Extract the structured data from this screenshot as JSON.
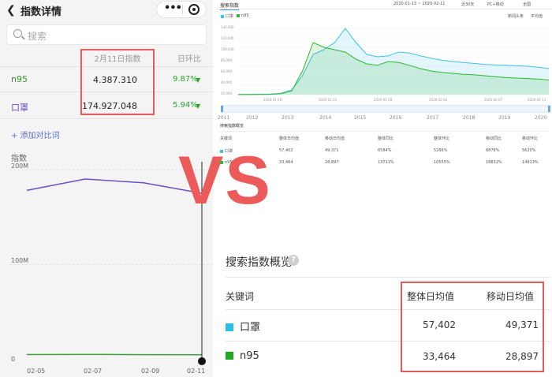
{
  "mobile": {
    "back_icon": "chevron-left-icon",
    "title": "指数详情",
    "capsule_more": "•••",
    "search_placeholder": "搜索",
    "header_date": "2月11日指数",
    "header_ring": "日环比",
    "rows": [
      {
        "keyword": "n95",
        "value": "4.387.310",
        "change": "9.87%",
        "color": "#3a8f2f"
      },
      {
        "keyword": "口罩",
        "value": "174.927.048",
        "change": "5.94%",
        "color": "#6c4fc4"
      }
    ],
    "add_compare": "+ 添加对比词",
    "chart_ylabel": "指数"
  },
  "vs_text": "VS",
  "desktop": {
    "tab": "搜索指数",
    "date_range": "2020-01-13 ~ 2020-02-11",
    "period": "近30天",
    "device": "PC+移动",
    "region": "全国",
    "legend": [
      "口罩",
      "n95"
    ],
    "options": [
      "新闻头条",
      "平均值"
    ],
    "summary_title": "搜索指数概览",
    "summary_headers": [
      "关键词",
      "整体日均值",
      "移动日均值",
      "整体同比",
      "整体环比",
      "移动同比",
      "移动环比"
    ],
    "summary_rows": [
      {
        "keyword": "口罩",
        "color": "#3fc0e8",
        "cells": [
          "57,402",
          "49,371",
          "6584%",
          "5266%",
          "6878%",
          "5620%"
        ]
      },
      {
        "keyword": "n95",
        "color": "#2eb82e",
        "cells": [
          "33,464",
          "28,897",
          "13711%",
          "10555%",
          "18832%",
          "14813%"
        ]
      }
    ],
    "range_years": [
      "2011",
      "2012",
      "2013",
      "2014",
      "2015",
      "2016",
      "2017",
      "2018",
      "2019",
      "2020"
    ]
  },
  "overview": {
    "title": "搜索指数概览",
    "help": "?",
    "col_keyword": "关键词",
    "col_total": "整体日均值",
    "col_mobile": "移动日均值",
    "rows": [
      {
        "keyword": "口罩",
        "color": "#29bfe6",
        "total": "57,402",
        "mobile": "49,371"
      },
      {
        "keyword": "n95",
        "color": "#22a822",
        "total": "33,464",
        "mobile": "28,897"
      }
    ]
  },
  "chart_data": [
    {
      "type": "line",
      "title": "",
      "ylabel": "指数",
      "x": [
        "02-05",
        "02-07",
        "02-09",
        "02-11"
      ],
      "y_ticks": [
        "0",
        "100M",
        "200M"
      ],
      "ylim": [
        0,
        200000000
      ],
      "series": [
        {
          "name": "口罩",
          "color": "#6c4fc4",
          "values": [
            178000000,
            190000000,
            186000000,
            174927048
          ]
        },
        {
          "name": "n95",
          "color": "#3aa33a",
          "values": [
            4600000,
            4700000,
            4500000,
            4387310
          ]
        }
      ]
    },
    {
      "type": "area",
      "title": "",
      "y_ticks": [
        "0",
        "20,000",
        "40,000",
        "60,000",
        "80,000",
        "100,000",
        "120,000",
        "140,000"
      ],
      "x_ticks": [
        "2020-01-16",
        "2020-01-22",
        "2020-01-28",
        "2020-02-02",
        "2020-02-07",
        "2020-02-11"
      ],
      "ylim": [
        0,
        150000
      ],
      "series": [
        {
          "name": "口罩",
          "color": "#3fc0e8",
          "values": [
            500,
            600,
            800,
            1200,
            3000,
            10000,
            40000,
            85000,
            95000,
            110000,
            140000,
            110000,
            85000,
            80000,
            82000,
            90000,
            88000,
            82000,
            77000,
            73000,
            70000,
            68000,
            66000,
            64000,
            63000,
            62000,
            61000,
            60000,
            58000,
            55000
          ]
        },
        {
          "name": "n95",
          "color": "#2eb82e",
          "values": [
            200,
            300,
            400,
            700,
            2000,
            8000,
            50000,
            110000,
            100000,
            95000,
            90000,
            75000,
            65000,
            62000,
            70000,
            68000,
            62000,
            55000,
            50000,
            47000,
            45000,
            43000,
            42000,
            40000,
            38000,
            36000,
            35000,
            34000,
            33000,
            31000
          ]
        }
      ]
    }
  ]
}
